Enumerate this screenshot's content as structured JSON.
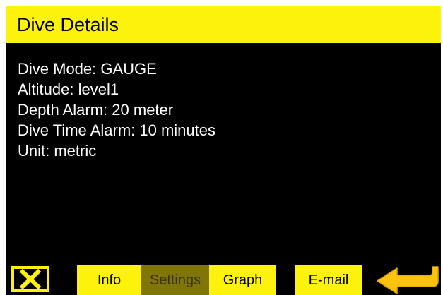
{
  "header": {
    "title": "Dive Details"
  },
  "details": [
    "Dive Mode: GAUGE",
    "Altitude: level1",
    "Depth Alarm: 20 meter",
    "Dive Time Alarm: 10 minutes",
    "Unit: metric"
  ],
  "toolbar": {
    "close_icon": "close-x-icon",
    "buttons": [
      {
        "label": "Info",
        "state": "enabled"
      },
      {
        "label": "Settings",
        "state": "selected-disabled"
      },
      {
        "label": "Graph",
        "state": "enabled"
      },
      {
        "label": "E-mail",
        "state": "enabled"
      }
    ],
    "back_icon": "return-arrow-icon"
  },
  "colors": {
    "accent": "#fdf20b",
    "background": "#000000",
    "text": "#ffffff",
    "disabled_button": "#807509"
  }
}
